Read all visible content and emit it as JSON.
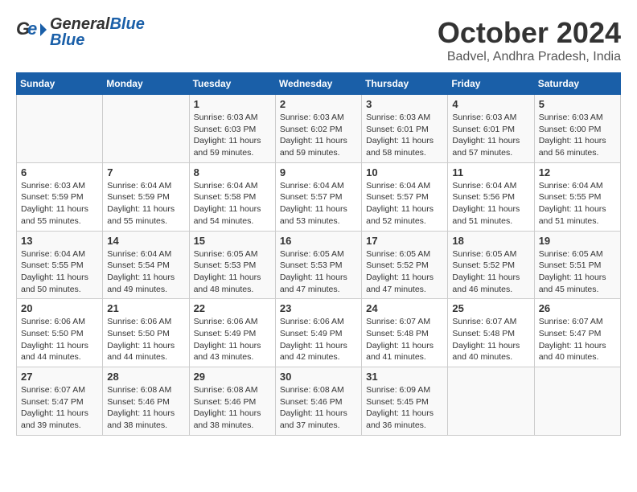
{
  "header": {
    "logo_general": "General",
    "logo_blue": "Blue",
    "month_title": "October 2024",
    "location": "Badvel, Andhra Pradesh, India"
  },
  "weekdays": [
    "Sunday",
    "Monday",
    "Tuesday",
    "Wednesday",
    "Thursday",
    "Friday",
    "Saturday"
  ],
  "weeks": [
    [
      {
        "day": "",
        "info": ""
      },
      {
        "day": "",
        "info": ""
      },
      {
        "day": "1",
        "info": "Sunrise: 6:03 AM\nSunset: 6:03 PM\nDaylight: 11 hours and 59 minutes."
      },
      {
        "day": "2",
        "info": "Sunrise: 6:03 AM\nSunset: 6:02 PM\nDaylight: 11 hours and 59 minutes."
      },
      {
        "day": "3",
        "info": "Sunrise: 6:03 AM\nSunset: 6:01 PM\nDaylight: 11 hours and 58 minutes."
      },
      {
        "day": "4",
        "info": "Sunrise: 6:03 AM\nSunset: 6:01 PM\nDaylight: 11 hours and 57 minutes."
      },
      {
        "day": "5",
        "info": "Sunrise: 6:03 AM\nSunset: 6:00 PM\nDaylight: 11 hours and 56 minutes."
      }
    ],
    [
      {
        "day": "6",
        "info": "Sunrise: 6:03 AM\nSunset: 5:59 PM\nDaylight: 11 hours and 55 minutes."
      },
      {
        "day": "7",
        "info": "Sunrise: 6:04 AM\nSunset: 5:59 PM\nDaylight: 11 hours and 55 minutes."
      },
      {
        "day": "8",
        "info": "Sunrise: 6:04 AM\nSunset: 5:58 PM\nDaylight: 11 hours and 54 minutes."
      },
      {
        "day": "9",
        "info": "Sunrise: 6:04 AM\nSunset: 5:57 PM\nDaylight: 11 hours and 53 minutes."
      },
      {
        "day": "10",
        "info": "Sunrise: 6:04 AM\nSunset: 5:57 PM\nDaylight: 11 hours and 52 minutes."
      },
      {
        "day": "11",
        "info": "Sunrise: 6:04 AM\nSunset: 5:56 PM\nDaylight: 11 hours and 51 minutes."
      },
      {
        "day": "12",
        "info": "Sunrise: 6:04 AM\nSunset: 5:55 PM\nDaylight: 11 hours and 51 minutes."
      }
    ],
    [
      {
        "day": "13",
        "info": "Sunrise: 6:04 AM\nSunset: 5:55 PM\nDaylight: 11 hours and 50 minutes."
      },
      {
        "day": "14",
        "info": "Sunrise: 6:04 AM\nSunset: 5:54 PM\nDaylight: 11 hours and 49 minutes."
      },
      {
        "day": "15",
        "info": "Sunrise: 6:05 AM\nSunset: 5:53 PM\nDaylight: 11 hours and 48 minutes."
      },
      {
        "day": "16",
        "info": "Sunrise: 6:05 AM\nSunset: 5:53 PM\nDaylight: 11 hours and 47 minutes."
      },
      {
        "day": "17",
        "info": "Sunrise: 6:05 AM\nSunset: 5:52 PM\nDaylight: 11 hours and 47 minutes."
      },
      {
        "day": "18",
        "info": "Sunrise: 6:05 AM\nSunset: 5:52 PM\nDaylight: 11 hours and 46 minutes."
      },
      {
        "day": "19",
        "info": "Sunrise: 6:05 AM\nSunset: 5:51 PM\nDaylight: 11 hours and 45 minutes."
      }
    ],
    [
      {
        "day": "20",
        "info": "Sunrise: 6:06 AM\nSunset: 5:50 PM\nDaylight: 11 hours and 44 minutes."
      },
      {
        "day": "21",
        "info": "Sunrise: 6:06 AM\nSunset: 5:50 PM\nDaylight: 11 hours and 44 minutes."
      },
      {
        "day": "22",
        "info": "Sunrise: 6:06 AM\nSunset: 5:49 PM\nDaylight: 11 hours and 43 minutes."
      },
      {
        "day": "23",
        "info": "Sunrise: 6:06 AM\nSunset: 5:49 PM\nDaylight: 11 hours and 42 minutes."
      },
      {
        "day": "24",
        "info": "Sunrise: 6:07 AM\nSunset: 5:48 PM\nDaylight: 11 hours and 41 minutes."
      },
      {
        "day": "25",
        "info": "Sunrise: 6:07 AM\nSunset: 5:48 PM\nDaylight: 11 hours and 40 minutes."
      },
      {
        "day": "26",
        "info": "Sunrise: 6:07 AM\nSunset: 5:47 PM\nDaylight: 11 hours and 40 minutes."
      }
    ],
    [
      {
        "day": "27",
        "info": "Sunrise: 6:07 AM\nSunset: 5:47 PM\nDaylight: 11 hours and 39 minutes."
      },
      {
        "day": "28",
        "info": "Sunrise: 6:08 AM\nSunset: 5:46 PM\nDaylight: 11 hours and 38 minutes."
      },
      {
        "day": "29",
        "info": "Sunrise: 6:08 AM\nSunset: 5:46 PM\nDaylight: 11 hours and 38 minutes."
      },
      {
        "day": "30",
        "info": "Sunrise: 6:08 AM\nSunset: 5:46 PM\nDaylight: 11 hours and 37 minutes."
      },
      {
        "day": "31",
        "info": "Sunrise: 6:09 AM\nSunset: 5:45 PM\nDaylight: 11 hours and 36 minutes."
      },
      {
        "day": "",
        "info": ""
      },
      {
        "day": "",
        "info": ""
      }
    ]
  ]
}
